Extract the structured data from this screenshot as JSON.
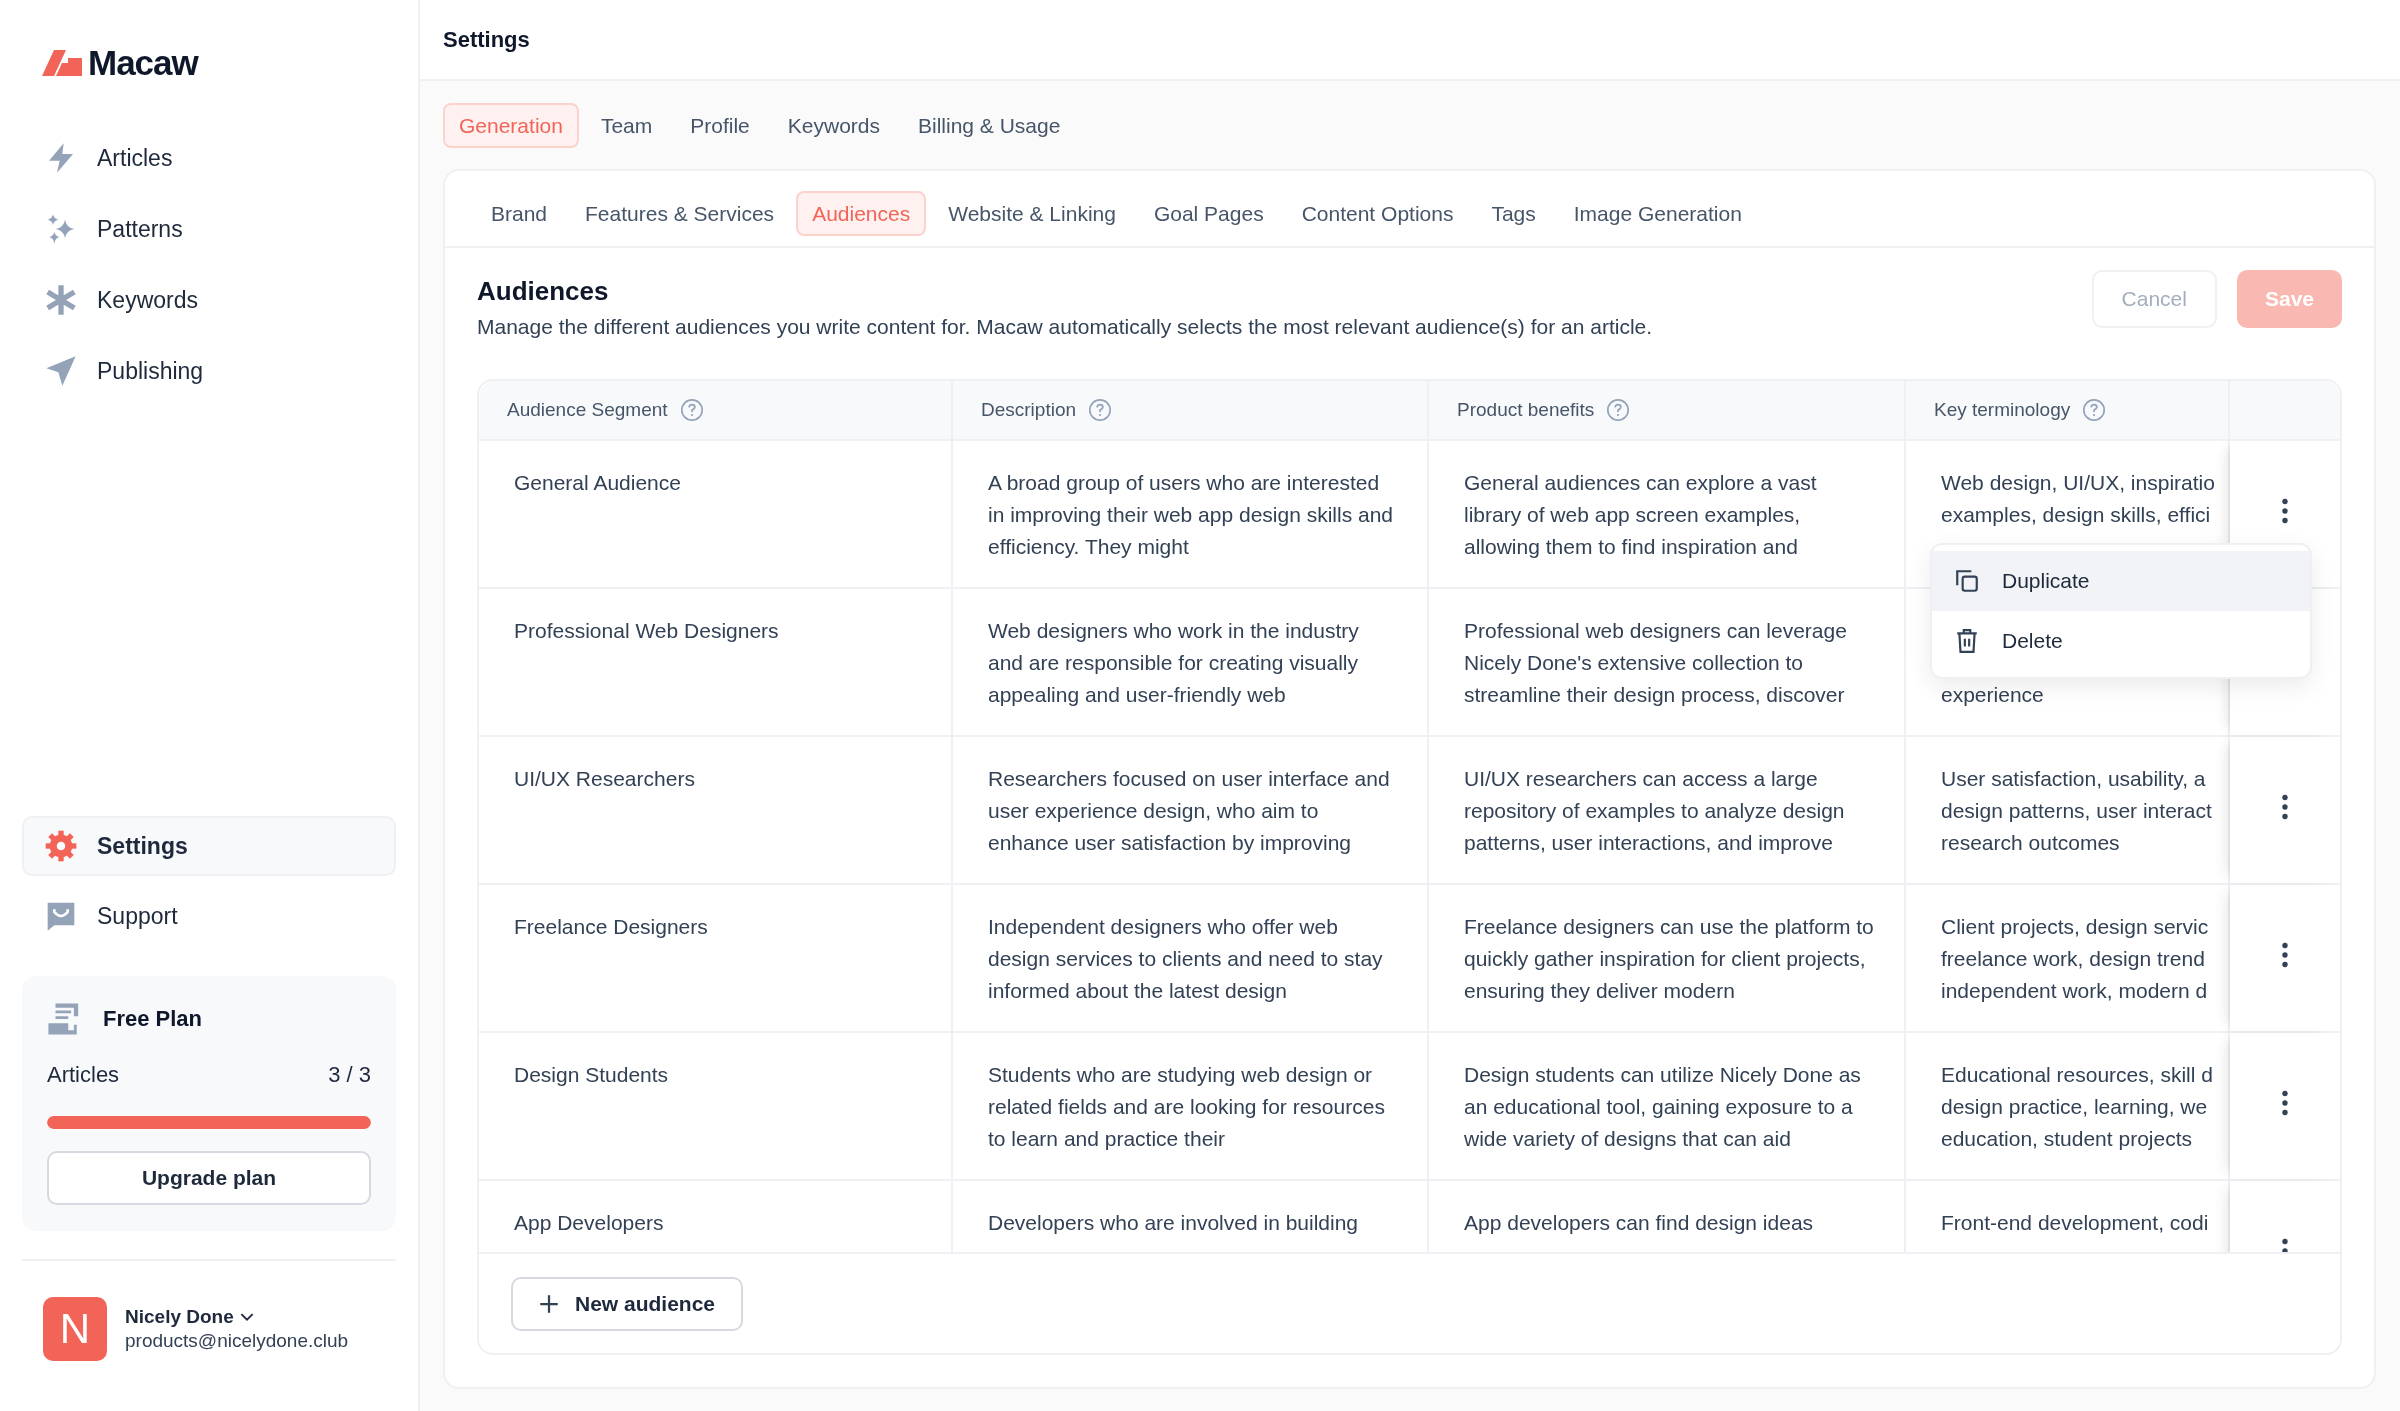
{
  "brand": {
    "name": "Macaw"
  },
  "nav": [
    {
      "label": "Articles"
    },
    {
      "label": "Patterns"
    },
    {
      "label": "Keywords"
    },
    {
      "label": "Publishing"
    }
  ],
  "bottom_nav": [
    {
      "label": "Settings",
      "selected": true
    },
    {
      "label": "Support",
      "selected": false
    }
  ],
  "plan": {
    "title": "Free Plan",
    "metric": "Articles",
    "usage": "3 / 3",
    "level": 1,
    "button": "Upgrade plan"
  },
  "user": {
    "initial": "N",
    "name": "Nicely Done",
    "email": "products@nicelydone.club"
  },
  "header": {
    "title": "Settings"
  },
  "tabs": [
    {
      "label": "Generation",
      "selected": true
    },
    {
      "label": "Team",
      "selected": false
    },
    {
      "label": "Profile",
      "selected": false
    },
    {
      "label": "Keywords",
      "selected": false
    },
    {
      "label": "Billing & Usage",
      "selected": false
    }
  ],
  "subtabs": [
    {
      "label": "Brand",
      "selected": false
    },
    {
      "label": "Features & Services",
      "selected": false
    },
    {
      "label": "Audiences",
      "selected": true
    },
    {
      "label": "Website & Linking",
      "selected": false
    },
    {
      "label": "Goal Pages",
      "selected": false
    },
    {
      "label": "Content Options",
      "selected": false
    },
    {
      "label": "Tags",
      "selected": false
    },
    {
      "label": "Image Generation",
      "selected": false
    }
  ],
  "section": {
    "title": "Audiences",
    "description": "Manage the different audiences you write content for. Macaw automatically selects the most relevant audience(s) for an article.",
    "cancel": {
      "label": "Cancel",
      "disabled": true
    },
    "save": {
      "label": "Save",
      "disabled": true
    }
  },
  "table": {
    "columns": [
      "Audience Segment",
      "Description",
      "Product benefits",
      "Key terminology"
    ],
    "rows": [
      {
        "segment": "General Audience",
        "description": "A broad group of users who are interested in improving their web app design skills and efficiency. They might",
        "benefits": "General audiences can explore a vast library of web app screen examples, allowing them to find inspiration and",
        "key_terms": [
          "Web design, UI/UX, inspiratio",
          "examples, design skills, effici"
        ]
      },
      {
        "segment": "Professional Web Designers",
        "description": "Web designers who work in the industry and are responsible for creating visually appealing and user-friendly web",
        "benefits": "Professional web designers can leverage Nicely Done's extensive collection to streamline their design process, discover",
        "key_terms": [
          "experience"
        ]
      },
      {
        "segment": "UI/UX Researchers",
        "description": "Researchers focused on user interface and user experience design, who aim to enhance user satisfaction by improving",
        "benefits": "UI/UX researchers can access a large repository of examples to analyze design patterns, user interactions, and improve",
        "key_terms": [
          "User satisfaction, usability, a",
          "design patterns, user interact",
          "research outcomes"
        ]
      },
      {
        "segment": "Freelance Designers",
        "description": "Independent designers who offer web design services to clients and need to stay informed about the latest design",
        "benefits": "Freelance designers can use the platform to quickly gather inspiration for client projects, ensuring they deliver modern",
        "key_terms": [
          "Client projects, design servic",
          "freelance work, design trend",
          "independent work, modern d"
        ]
      },
      {
        "segment": "Design Students",
        "description": "Students who are studying web design or related fields and are looking for resources to learn and practice their",
        "benefits": "Design students can utilize Nicely Done as an educational tool, gaining exposure to a wide variety of designs that can aid",
        "key_terms": [
          "Educational resources, skill d",
          "design practice, learning, we",
          "education, student projects"
        ]
      },
      {
        "segment": "App Developers",
        "description": "Developers who are involved in building",
        "benefits": "App developers can find design ideas",
        "key_terms": [
          "Front-end development, codi"
        ]
      }
    ],
    "add_button": "New audience"
  },
  "row_menu": {
    "items": [
      {
        "label": "Duplicate",
        "highlighted": true
      },
      {
        "label": "Delete",
        "highlighted": false
      }
    ]
  }
}
